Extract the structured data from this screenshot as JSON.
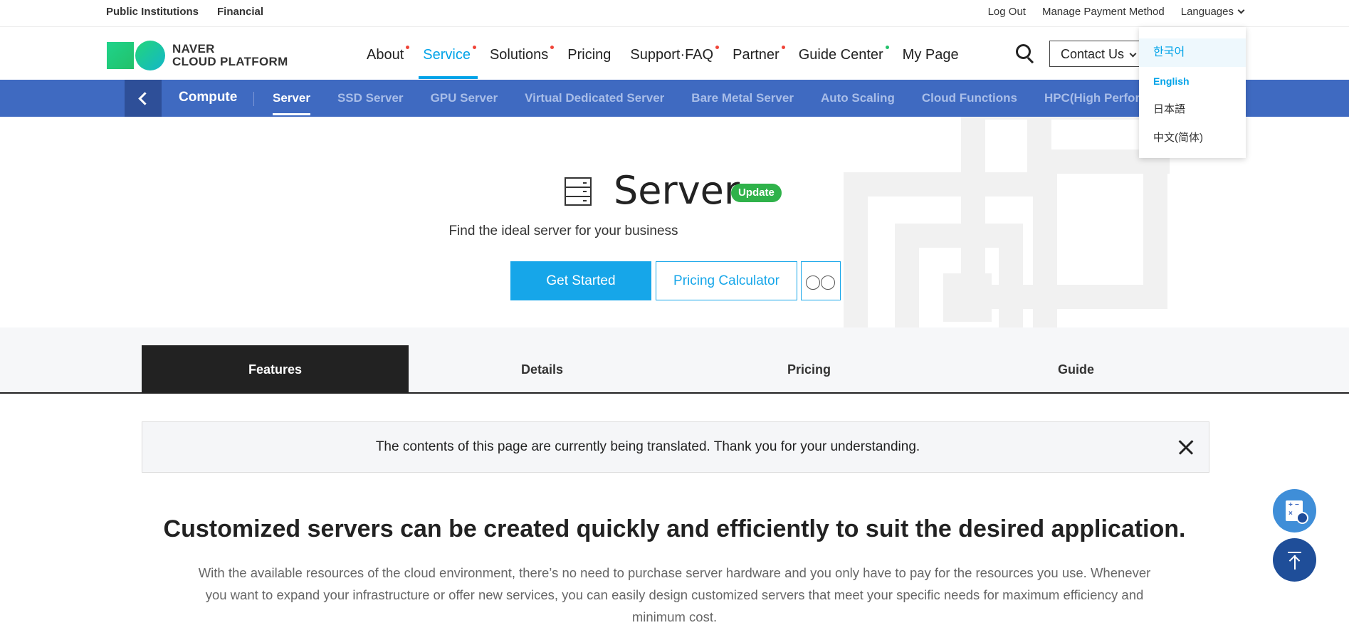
{
  "util": {
    "left": [
      "Public Institutions",
      "Financial"
    ],
    "logout": "Log Out",
    "payment": "Manage Payment Method",
    "languages": "Languages"
  },
  "header": {
    "logo_line1": "NAVER",
    "logo_line2": "CLOUD PLATFORM",
    "nav": [
      "About",
      "Service",
      "Solutions",
      "Pricing",
      "Support·FAQ",
      "Partner",
      "Guide Center",
      "My Page"
    ],
    "contact": "Contact Us"
  },
  "lang_menu": [
    "한국어",
    "English",
    "日本語",
    "中文(简体)"
  ],
  "subnav": {
    "category": "Compute",
    "items": [
      "Server",
      "SSD Server",
      "GPU Server",
      "Virtual Dedicated Server",
      "Bare Metal Server",
      "Auto Scaling",
      "Cloud Functions",
      "HPC(High Performance Computing)"
    ]
  },
  "hero": {
    "title": "Server",
    "badge": "Update",
    "subtitle": "Find the ideal server for your business",
    "btn_start": "Get Started",
    "btn_calc": "Pricing Calculator"
  },
  "tabs": [
    "Features",
    "Details",
    "Pricing",
    "Guide"
  ],
  "notice": "The contents of this page are currently being translated. Thank you for your understanding.",
  "content": {
    "title": "Customized servers can be created quickly and efficiently to suit the desired application.",
    "desc": "With the available resources of the cloud environment, there’s no need to purchase server hardware and you only have to pay for the resources you use. Whenever you want to expand your infrastructure or offer new services, you can easily design customized servers that meet your specific needs for maximum efficiency and minimum cost."
  }
}
